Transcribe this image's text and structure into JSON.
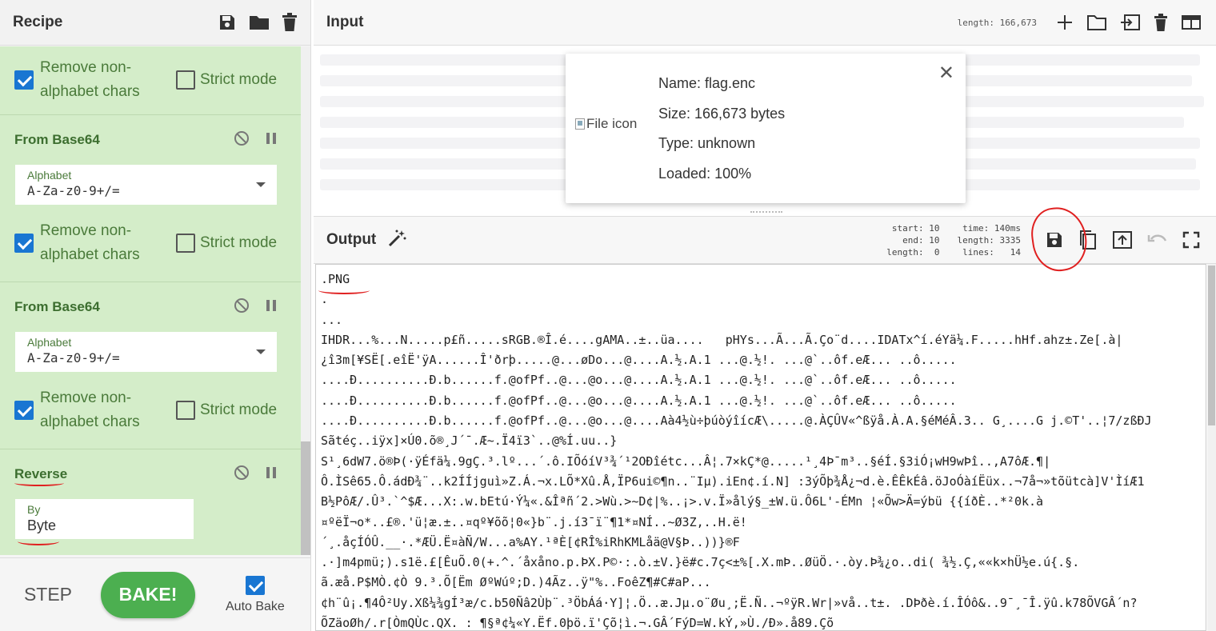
{
  "recipe": {
    "title": "Recipe",
    "operations": [
      {
        "kind": "checkbox-row",
        "remove_label": "Remove non-alphabet chars",
        "strict_label": "Strict mode"
      },
      {
        "kind": "op",
        "name": "From Base64",
        "alphabet_label": "Alphabet",
        "alphabet_value": "A-Za-z0-9+/=",
        "remove_label": "Remove non-alphabet chars",
        "strict_label": "Strict mode"
      },
      {
        "kind": "op",
        "name": "From Base64",
        "alphabet_label": "Alphabet",
        "alphabet_value": "A-Za-z0-9+/=",
        "remove_label": "Remove non-alphabet chars",
        "strict_label": "Strict mode"
      },
      {
        "kind": "op",
        "name": "Reverse",
        "by_label": "By",
        "by_value": "Byte"
      }
    ],
    "step_label": "STEP",
    "bake_label": "BAKE!",
    "autobake_label": "Auto Bake"
  },
  "input": {
    "title": "Input",
    "length": "length: 166,673",
    "file": {
      "icon_alt": "File icon",
      "name": "Name: flag.enc",
      "size": "Size: 166,673 bytes",
      "type": "Type: unknown",
      "loaded": "Loaded: 100%"
    }
  },
  "output": {
    "title": "Output",
    "stats": {
      "col1": "start: 10\n  end: 10\nlength:  0",
      "col2": "time: 140ms\nlength: 3335\n lines:   14"
    },
    "lines": [
      ".PNG",
      ".",
      "...",
      "IHDR...%...N.....p£ñ.....sRGB.®Î.é....gAMA..±..üa....   pHYs...Ã...Ã.Ço¨d....IDATx^í.éYä¼.F.....hHf.ahz±.Ze[.à|",
      "¿î3m[¥SË[.eîË'ÿA......Î'ðrþ.....@...øDo...@....A.½.A.1 ...@.½!. ...@`..ôf.eÆ... ..ô.....",
      "....Ð..........Ð.b......f.@ofPf..@...@o...@....A.½.A.1 ...@.½!. ...@`..ôf.eÆ... ..ô.....",
      "....Ð..........Ð.b......f.@ofPf..@...@o...@....A.½.A.1 ...@.½!. ...@`..ôf.eÆ... ..ô.....",
      "....Ð..........Ð.b......f.@ofPf..@...@o...@....Aà4½ù÷þúòýîícÆ\\.....@.ÀÇÛV«^ßÿå.À.A.§éMéÂ.3.. G¸....G j.©T'..¦7/zßÐJ",
      "Sãtéç..iÿx]×Ú0.õ®¸J´¯.Æ~.Ï4ï3`..@%Í.uu..}",
      "S¹¸6dW7.ö®Þ(·ÿÉfä¼.9gÇ.³.lº...´.ô.IÕóíV³¾´¹2OÐîétc...Â¦.7×kÇ*@.....¹¸4Þ¯m³..§éÍ.§3iÓ¡wH9wÞî..,A7ôÆ.¶|",
      "Ô.ÌSê65.Ô.ádÐ¾¨..k2ÍÍjguì»Z.Á.¬x.LÕ*Xû.Å,ÏP6ui©¶n..¨Iµ).iEn¢.í.N] :3ýÕþ¾Å¿¬d.è.ÊÊkÉâ.öJoÓàíËüx..¬7å¬»tõütcà]V'ÌíÆ1",
      "B½PôÆ/.Û³.`^$Æ...X:.w.bEtú·Ý¼«.&Îªñ´2.>Wù.>~D¢|%..¡>.v.Ï»ålý§_±W.ü.Ô6L'-ÉMn ¦«Õw>Ä=ýbü {{íðÈ..*²0k.à",
      "¤ºëÏ¬o*..£®.'ü¦æ.±..¤qº¥õõ¦0«}b¨.j.í3¯ï¨¶1*¤NÍ..~Ø3Z,..H.ë!",
      "´¸.åçÍÓÛ.__·.*ÆÜ.Ë¤àÑ/W...a%AY.¹ªÈ[¢RÎ%iRhKMLåä@V§Þ..))}®F",
      ".·]m4pmü;).s1ë.£[ÊuÕ.0(+.^.´åxåno.p.ÞX.P©·:.ò.±V.}ë#c.7ç<±%[.X.mÞ..ØüÖ.·.òy.Þ¾¿o..di( ¾½.Ç,««k×hÜ½e.ú{.§.",
      "ã.æå.P$MÒ.¢Ò 9.³.Õ[Ëm ØºWúº;D.)4Ãz..ÿ\"%..FoêZ¶#C#aP...",
      "¢h¨û¡.¶4Ô²Uy.Xß¼¾gÍ³æ/c.b50Ñâ2Ùþ¨.³ÖbÁá·Y]¦.Ö..æ.Jµ.o¨Øu¸;Ë.Ñ..¬ºÿR.Wr|»vå..t±. .DÞðè.í.ÎÓô&..9¯¸¯Î.ÿû.k78ÕVGÂ´n?",
      "ÕZäoØh/.r[ÒmQÙc.QX. : ¶§ª¢¼«Y.Ëf.0þö.ï'Çõ¦ì.¬.GÂ´FýD=W.kÝ,»Ù./Ð».å89.Çõ"
    ]
  },
  "annotation_color": "#e02020",
  "accent": "#1976d2",
  "bake_color": "#4caf50",
  "op_bg": "#d4edc9"
}
